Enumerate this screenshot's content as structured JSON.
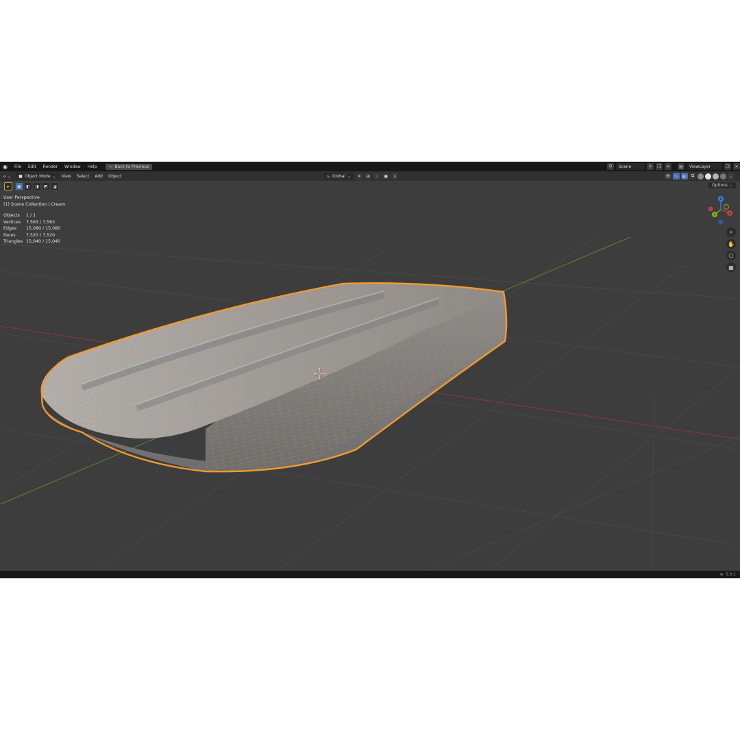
{
  "app": {
    "logo_icon": "blender-logo-icon",
    "menus": [
      "File",
      "Edit",
      "Render",
      "Window",
      "Help"
    ],
    "back_button": "Back to Previous",
    "scene_name": "Scene",
    "view_layer_name": "ViewLayer"
  },
  "header": {
    "editor_type_icon": "3d-viewport-icon",
    "mode": "Object Mode",
    "menus": [
      "View",
      "Select",
      "Add",
      "Object"
    ],
    "transform_orientation": "Global",
    "options_label": "Options"
  },
  "overlay": {
    "view_name": "User Perspective",
    "collection": "(1) Scene Collection | Cream",
    "stats": [
      {
        "label": "Objects",
        "value": "1 / 1"
      },
      {
        "label": "Vertices",
        "value": "7,563 / 7,563"
      },
      {
        "label": "Edges",
        "value": "15,080 / 15,080"
      },
      {
        "label": "Faces",
        "value": "7,520 / 7,520"
      },
      {
        "label": "Triangles",
        "value": "15,040 / 15,040"
      }
    ]
  },
  "gizmo": {
    "axes": [
      "X",
      "Y",
      "Z"
    ],
    "colors": {
      "x": "#c8404a",
      "y": "#7ab12b",
      "z": "#3a7fd6"
    }
  },
  "nav_icons": [
    "zoom-icon",
    "pan-hand-icon",
    "camera-view-icon",
    "grid-perspective-icon"
  ],
  "colors": {
    "selection_outline": "#f29a2e",
    "mesh_surface": "#9a9a9a",
    "viewport_bg": "#3d3d3d",
    "x_axis_line": "#8a3838",
    "y_axis_line": "#5b7f2e"
  },
  "status": {
    "version": "5.0.1"
  }
}
